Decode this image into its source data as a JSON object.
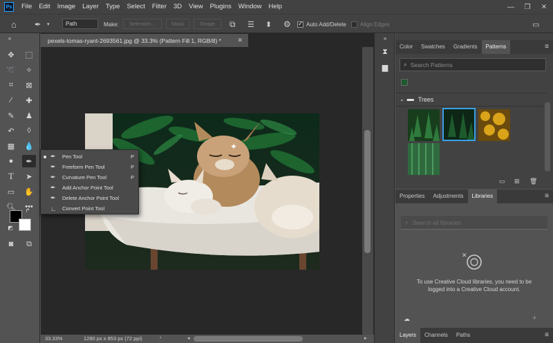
{
  "app": {
    "logo": "Ps"
  },
  "menu": [
    "File",
    "Edit",
    "Image",
    "Layer",
    "Type",
    "Select",
    "Filter",
    "3D",
    "View",
    "Plugins",
    "Window",
    "Help"
  ],
  "options": {
    "mode_value": "Path",
    "make_label": "Make:",
    "selection_btn": "Selection...",
    "mask_btn": "Mask",
    "shape_btn": "Shape",
    "auto_add_delete": "Auto Add/Delete",
    "align_edges": "Align Edges"
  },
  "document": {
    "tab_title": "pexels-tomas-ryant-2693561.jpg @ 33.3% (Pattern Fill 1, RGB/8) *",
    "zoom": "33.33%",
    "info": "1280 px x 853 px (72 ppi)"
  },
  "flyout": {
    "items": [
      {
        "label": "Pen Tool",
        "key": "P",
        "icon": "pen-icon"
      },
      {
        "label": "Freeform Pen Tool",
        "key": "P",
        "icon": "freeform-pen-icon"
      },
      {
        "label": "Curvature Pen Tool",
        "key": "P",
        "icon": "curvature-pen-icon"
      },
      {
        "label": "Add Anchor Point Tool",
        "key": "",
        "icon": "add-anchor-icon"
      },
      {
        "label": "Delete Anchor Point Tool",
        "key": "",
        "icon": "delete-anchor-icon"
      },
      {
        "label": "Convert Point Tool",
        "key": "",
        "icon": "convert-point-icon"
      }
    ]
  },
  "patterns_panel": {
    "tabs": [
      "Color",
      "Swatches",
      "Gradients",
      "Patterns"
    ],
    "search_placeholder": "Search Patterns",
    "group_name": "Trees"
  },
  "libraries_panel": {
    "tabs": [
      "Properties",
      "Adjustments",
      "Libraries"
    ],
    "search_placeholder": "Search all libraries",
    "message": "To use Creative Cloud libraries, you need to be logged into a Creative Cloud account."
  },
  "layers_panel": {
    "tabs": [
      "Layers",
      "Channels",
      "Paths"
    ]
  },
  "colors": {
    "app_bg": "#535353",
    "bar_bg": "#424242",
    "canvas_bg": "#282828",
    "selected_swatch_border": "#3aa0e8"
  }
}
